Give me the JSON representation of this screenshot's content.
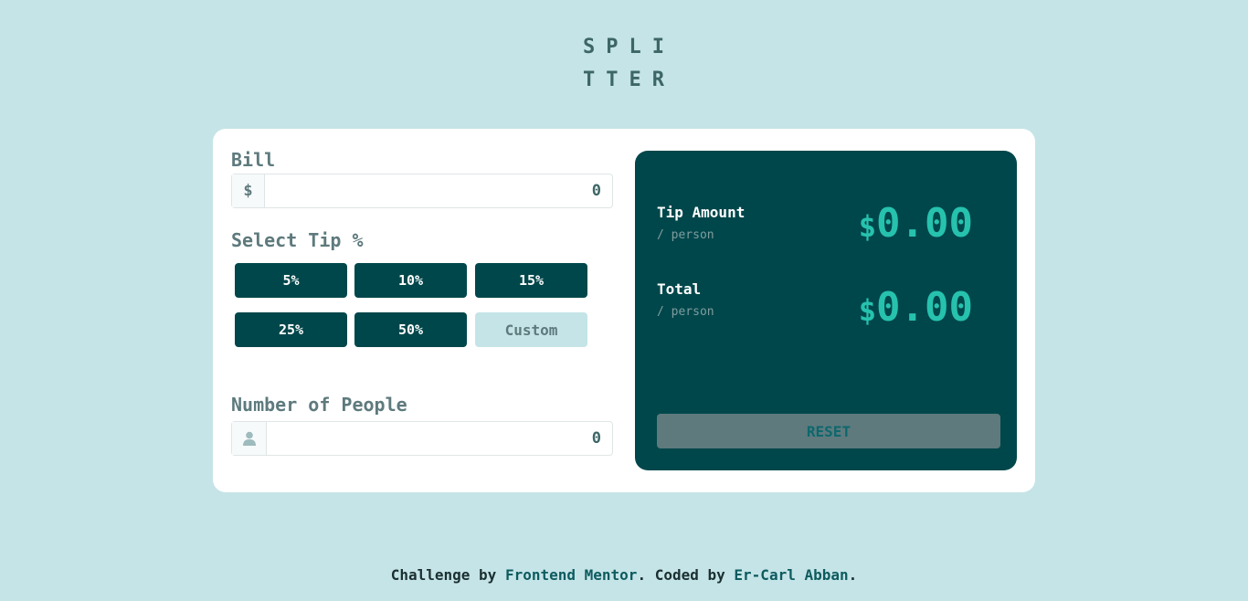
{
  "logo": {
    "line1": "SPLI",
    "line2": "TTER"
  },
  "bill": {
    "label": "Bill",
    "currency_symbol": "$",
    "value": "0"
  },
  "tip": {
    "label": "Select Tip %",
    "options": [
      "5%",
      "10%",
      "15%",
      "25%",
      "50%"
    ],
    "custom_placeholder": "Custom"
  },
  "people": {
    "label": "Number of People",
    "value": "0",
    "icon": "person-icon"
  },
  "results": {
    "tip_amount": {
      "title": "Tip Amount",
      "sub": "/ person",
      "currency": "$",
      "value": "0.00"
    },
    "total": {
      "title": "Total",
      "sub": "/ person",
      "currency": "$",
      "value": "0.00"
    },
    "reset_label": "RESET"
  },
  "footer": {
    "prefix": "Challenge by ",
    "link1": "Frontend Mentor",
    "middle": ". Coded by ",
    "link2": "Er-Carl Abban",
    "suffix": "."
  },
  "colors": {
    "background": "#c5e4e7",
    "dark_cyan": "#00474b",
    "accent": "#26c2ae",
    "muted": "#5e7a7d"
  }
}
